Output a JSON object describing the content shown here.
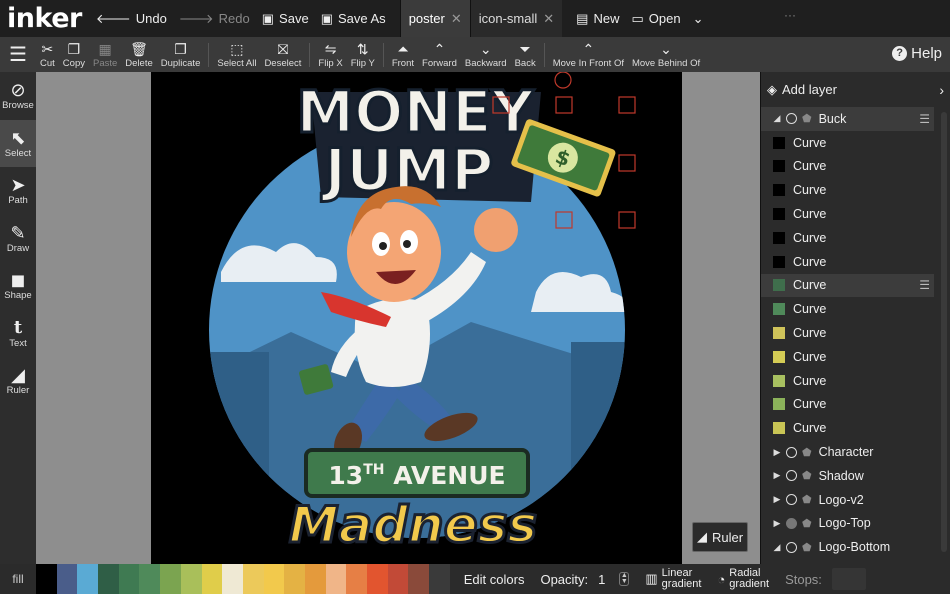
{
  "app": {
    "logo": "inker"
  },
  "topbar": {
    "undo": "Undo",
    "redo": "Redo",
    "save": "Save",
    "save_as": "Save As",
    "tabs": [
      {
        "label": "poster",
        "active": true
      },
      {
        "label": "icon-small",
        "active": false
      }
    ],
    "new": "New",
    "open": "Open"
  },
  "toolbar": {
    "items": [
      "Cut",
      "Copy",
      "Paste",
      "Delete",
      "Duplicate",
      "Select All",
      "Deselect",
      "Flip X",
      "Flip Y",
      "Front",
      "Forward",
      "Backward",
      "Back",
      "Move In Front Of",
      "Move Behind Of"
    ],
    "help": "Help"
  },
  "lefttools": [
    "Browse",
    "Select",
    "Path",
    "Draw",
    "Shape",
    "Text",
    "Ruler"
  ],
  "poster": {
    "title_line1": "MONEY",
    "title_line2": "JUMP",
    "sign_top": "13",
    "sign_top_sup": "TH",
    "sign_top_rest": " AVENUE",
    "sign_bottom": "Madness",
    "bill_symbol": "$"
  },
  "canvas": {
    "ruler_button": "Ruler"
  },
  "layers": {
    "add_layer": "Add layer",
    "items": [
      {
        "label": "Buck",
        "kind": "group",
        "expanded": true,
        "selected": true,
        "menu": true
      },
      {
        "label": "Curve",
        "swatch": "#000000"
      },
      {
        "label": "Curve",
        "swatch": "#000000"
      },
      {
        "label": "Curve",
        "swatch": "#000000"
      },
      {
        "label": "Curve",
        "swatch": "#000000"
      },
      {
        "label": "Curve",
        "swatch": "#000000"
      },
      {
        "label": "Curve",
        "swatch": "#000000"
      },
      {
        "label": "Curve",
        "swatch": "#3f6e4c",
        "selected": true,
        "menu": true
      },
      {
        "label": "Curve",
        "swatch": "#4f8a5a"
      },
      {
        "label": "Curve",
        "swatch": "#cfc35a"
      },
      {
        "label": "Curve",
        "swatch": "#d4cc55"
      },
      {
        "label": "Curve",
        "swatch": "#a8c060"
      },
      {
        "label": "Curve",
        "swatch": "#8bb25a"
      },
      {
        "label": "Curve",
        "swatch": "#c9c555"
      },
      {
        "label": "Character",
        "kind": "group",
        "expanded": false
      },
      {
        "label": "Shadow",
        "kind": "group",
        "expanded": false
      },
      {
        "label": "Logo-v2",
        "kind": "group",
        "expanded": false
      },
      {
        "label": "Logo-Top",
        "kind": "group",
        "expanded": false,
        "hidden": true
      },
      {
        "label": "Logo-Bottom",
        "kind": "group",
        "expanded": true
      }
    ]
  },
  "bottombar": {
    "fill": "fill",
    "palette": [
      "#000000",
      "#4a5d8a",
      "#5aaad4",
      "#2f5e46",
      "#3f7a52",
      "#4f8a5a",
      "#7ba450",
      "#a9bf5a",
      "#e0cd4a",
      "#efe9d4",
      "#ecc95a",
      "#f2c94c",
      "#e4b244",
      "#e49a3c",
      "#f0b588",
      "#e67f45",
      "#e2552f",
      "#c24a37",
      "#8a4a3a",
      "#3a3a3a"
    ],
    "edit_colors": "Edit colors",
    "opacity_label": "Opacity:",
    "opacity_value": "1",
    "linear_1": "Linear",
    "linear_2": "gradient",
    "radial_1": "Radial",
    "radial_2": "gradient",
    "stops": "Stops:"
  }
}
